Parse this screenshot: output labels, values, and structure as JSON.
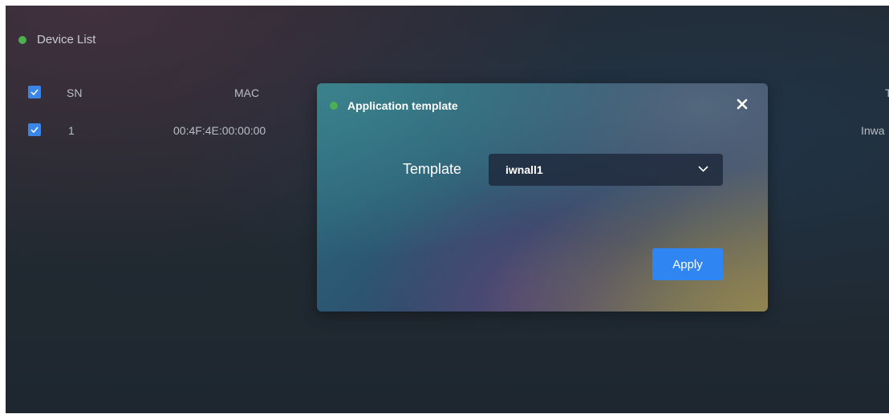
{
  "panel": {
    "title": "Device List",
    "status_color": "#4caf50"
  },
  "table": {
    "columns": [
      "SN",
      "MAC",
      "T"
    ],
    "rows": [
      {
        "sn": "1",
        "mac": "00:4F:4E:00:00:00",
        "t": "Inwa",
        "checked": true
      }
    ],
    "header_checked": true
  },
  "dialog": {
    "title": "Application template",
    "status_color": "#4caf50",
    "close_icon": "close-icon",
    "field_label": "Template",
    "select_value": "iwnall1",
    "apply_label": "Apply",
    "accent": "#2f86f2"
  }
}
